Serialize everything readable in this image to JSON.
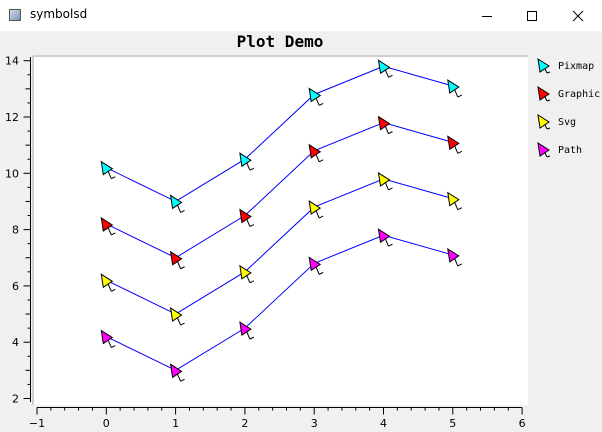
{
  "window": {
    "title": "symbolsd",
    "minimize_icon": "minimize-icon",
    "maximize_icon": "maximize-icon",
    "close_icon": "close-icon"
  },
  "colors": {
    "line": "#0000ff",
    "Path": "#ff00ff",
    "Svg": "#ffff00",
    "Graphic": "#ff0000",
    "Pixmap": "#00ffff"
  },
  "chart_data": {
    "type": "line",
    "title": "Plot Demo",
    "xlim": [
      -1,
      6
    ],
    "ylim": [
      2,
      14
    ],
    "x_ticks": [
      -1,
      0,
      1,
      2,
      3,
      4,
      5,
      6
    ],
    "y_ticks": [
      2,
      4,
      6,
      8,
      10,
      12,
      14
    ],
    "x": [
      0,
      1,
      2,
      3,
      4,
      5
    ],
    "series": [
      {
        "name": "Path",
        "values": [
          4.2,
          3.0,
          4.5,
          6.8,
          7.8,
          7.1
        ]
      },
      {
        "name": "Svg",
        "values": [
          6.2,
          5.0,
          6.5,
          8.8,
          9.8,
          9.1
        ]
      },
      {
        "name": "Graphic",
        "values": [
          8.2,
          7.0,
          8.5,
          10.8,
          11.8,
          11.1
        ]
      },
      {
        "name": "Pixmap",
        "values": [
          10.2,
          9.0,
          10.5,
          12.8,
          13.8,
          13.1
        ]
      }
    ],
    "legend_position": "right"
  }
}
